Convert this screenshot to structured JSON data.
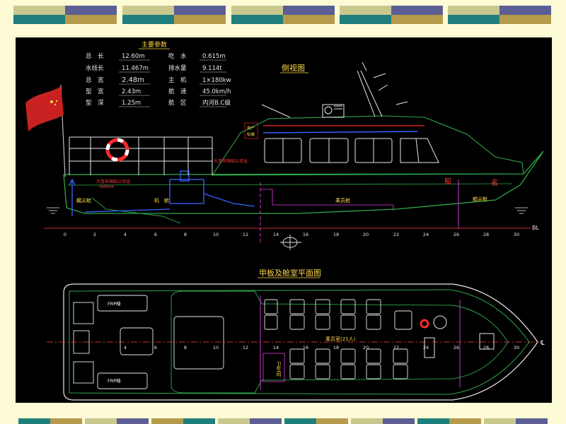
{
  "slide": {
    "background": "#fdfbd6",
    "band_colors": [
      "#c9c88f",
      "#1f7f7c",
      "#5b5f94",
      "#b69a4c"
    ]
  },
  "title_block": {
    "heading": "主要参数",
    "rows": [
      {
        "label": "总　长",
        "value": "12.60m",
        "label2": "吃　水",
        "value2": "0.615m"
      },
      {
        "label": "水线长",
        "value": "11.467m",
        "label2": "排水量",
        "value2": "9.114t"
      },
      {
        "label": "总　宽",
        "value": "2.48m",
        "label2": "主　机",
        "value2": "1×180kw"
      },
      {
        "label": "型　宽",
        "value": "2.43m",
        "label2": "航　速",
        "value2": "45.0km/h"
      },
      {
        "label": "型　深",
        "value": "1.25m",
        "label2": "航　区",
        "value2": "内河B.C级"
      }
    ]
  },
  "side_view": {
    "title": "侧视图",
    "labels": {
      "owner_badge": [
        "用户",
        "标徽"
      ],
      "company": "大连丰顺船公司设",
      "ship_name_1": "船",
      "ship_name_2": "名",
      "engine_note_1": "大连丰顺船公司设",
      "engine_note_2": "YAMAHA",
      "aft_compartment": "艉尖舱",
      "engine_room": "机　舱",
      "passenger_cabin": "乘员舱",
      "fore_compartment": "艏尖舱",
      "baseline": "BL"
    },
    "frames": [
      "0",
      "2",
      "4",
      "6",
      "8",
      "10",
      "12",
      "14",
      "16",
      "18",
      "20",
      "22",
      "24",
      "26",
      "28",
      "30"
    ]
  },
  "plan_view": {
    "title": "甲板及舱室平面图",
    "labels": {
      "seat_top": "FRP椅",
      "seat_bottom": "FRP椅",
      "crew_room": "乘员室(21人)",
      "toilet": "卫生间",
      "centerline": "℄"
    },
    "frames": [
      "4",
      "6",
      "8",
      "10",
      "12",
      "14",
      "16",
      "18",
      "20",
      "22",
      "24",
      "26",
      "28",
      "30"
    ]
  }
}
